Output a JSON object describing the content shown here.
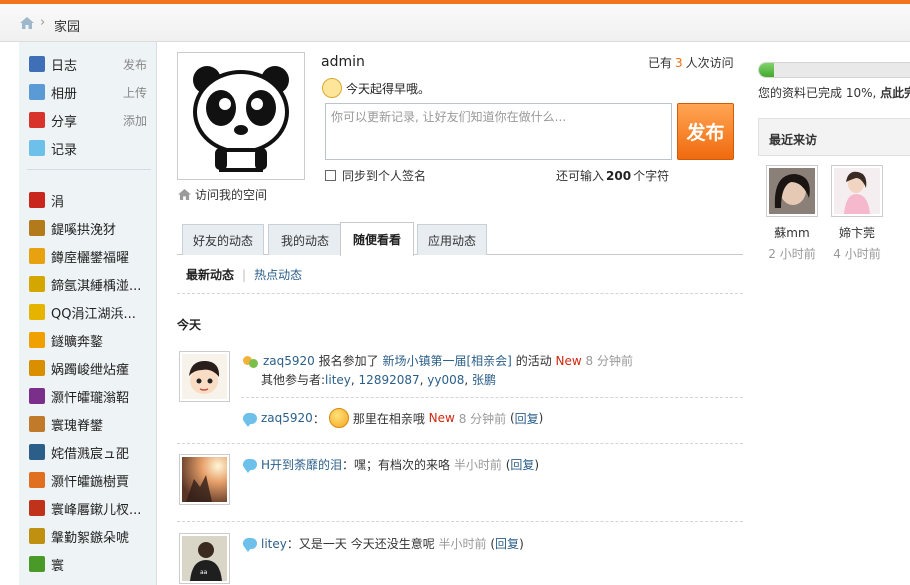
{
  "breadcrumb": {
    "home_icon": "home-icon",
    "current": "家园"
  },
  "sidebar": {
    "apps": [
      {
        "label": "日志",
        "action": "发布",
        "icon": "blog-icon",
        "color": "#3f6fb6"
      },
      {
        "label": "相册",
        "action": "上传",
        "icon": "photo-icon",
        "color": "#5a9bd5"
      },
      {
        "label": "分享",
        "action": "添加",
        "icon": "share-heart-icon",
        "color": "#d9342b"
      },
      {
        "label": "记录",
        "action": "",
        "icon": "speech-bubble-icon",
        "color": "#6cc0ea"
      }
    ],
    "games": [
      {
        "label": "涓",
        "icon": "game-icon-1",
        "color": "#c9261d"
      },
      {
        "label": "鍉嗘拱浼犲",
        "icon": "game-icon-2",
        "color": "#b37a1c"
      },
      {
        "label": "鐏庢欐鐢福曜",
        "icon": "game-icon-3",
        "color": "#e8a20f"
      },
      {
        "label": "鍗氬淇綞楀湴...",
        "icon": "game-icon-4",
        "color": "#d4a600"
      },
      {
        "label": "QQ涓江湖浜...",
        "icon": "game-icon-5",
        "color": "#e6b400"
      },
      {
        "label": "鐩曠奔鐜",
        "icon": "game-icon-6",
        "color": "#f0a000"
      },
      {
        "label": "娲躅峻绁炶瘽",
        "icon": "game-icon-7",
        "color": "#d98f00"
      },
      {
        "label": "灏忓皬瓏滃鞀",
        "icon": "game-icon-8",
        "color": "#7a2f8a"
      },
      {
        "label": "寰瑰脊鐢",
        "icon": "game-icon-9",
        "color": "#c07a2a"
      },
      {
        "label": "姹借溅宸ュ巶",
        "icon": "game-icon-10",
        "color": "#2b5f8a"
      },
      {
        "label": "灏忓皬鍦樹賈",
        "icon": "game-icon-11",
        "color": "#e07020"
      },
      {
        "label": "寰峰厬鏉儿杈...",
        "icon": "game-icon-12",
        "color": "#c0321a"
      },
      {
        "label": "鞶勤絮鏃朵唬",
        "icon": "game-icon-13",
        "color": "#c09010"
      },
      {
        "label": "寰",
        "icon": "sprout-icon",
        "color": "#4a9a2a"
      }
    ]
  },
  "profile": {
    "avatar": "panda-avatar",
    "visit_space": "访问我的空间",
    "username": "admin",
    "visitors_prefix": "已有",
    "visitors_count": "3",
    "visitors_suffix": "人次访问",
    "mood": "今天起得早哦。",
    "status_placeholder": "你可以更新记录, 让好友们知道你在做什么...",
    "publish_label": "发布",
    "sync_label": "同步到个人签名",
    "char_prefix": "还可输入",
    "char_count": "200",
    "char_suffix": "个字符"
  },
  "tabs": [
    "好友的动态",
    "我的动态",
    "随便看看",
    "应用动态"
  ],
  "subtabs": {
    "latest": "最新动态",
    "hot": "热点动态"
  },
  "feed": {
    "section": "今天",
    "items": [
      {
        "user": "zaq5920",
        "action": "报名参加了",
        "event": "新场小镇第一届[相亲会]",
        "suffix": "的活动",
        "new": "New",
        "time": "8 分钟前",
        "others_label": "其他参与者:",
        "others": [
          "litey",
          "12892087",
          "yy008",
          "张鹏"
        ]
      },
      {
        "user": "zaq5920",
        "text": "那里在相亲哦",
        "new": "New",
        "time": "8 分钟前",
        "reply": "回复"
      },
      {
        "user": "H开到荼靡的泪",
        "text": "嘿；有档次的来咯",
        "time": "半小时前",
        "reply": "回复"
      },
      {
        "user": "litey",
        "text": "又是一天  今天还没生意呢",
        "time": "半小时前",
        "reply": "回复"
      }
    ]
  },
  "right": {
    "progress_fraction": 0.1,
    "progress_text": "您的资料已完成 10%,",
    "progress_link": "点此完",
    "recent_title": "最近来访",
    "visitors": [
      {
        "name": "蘇mm",
        "time": "2 小时前"
      },
      {
        "name": "媂卞莞",
        "time": "4 小时前"
      }
    ]
  }
}
